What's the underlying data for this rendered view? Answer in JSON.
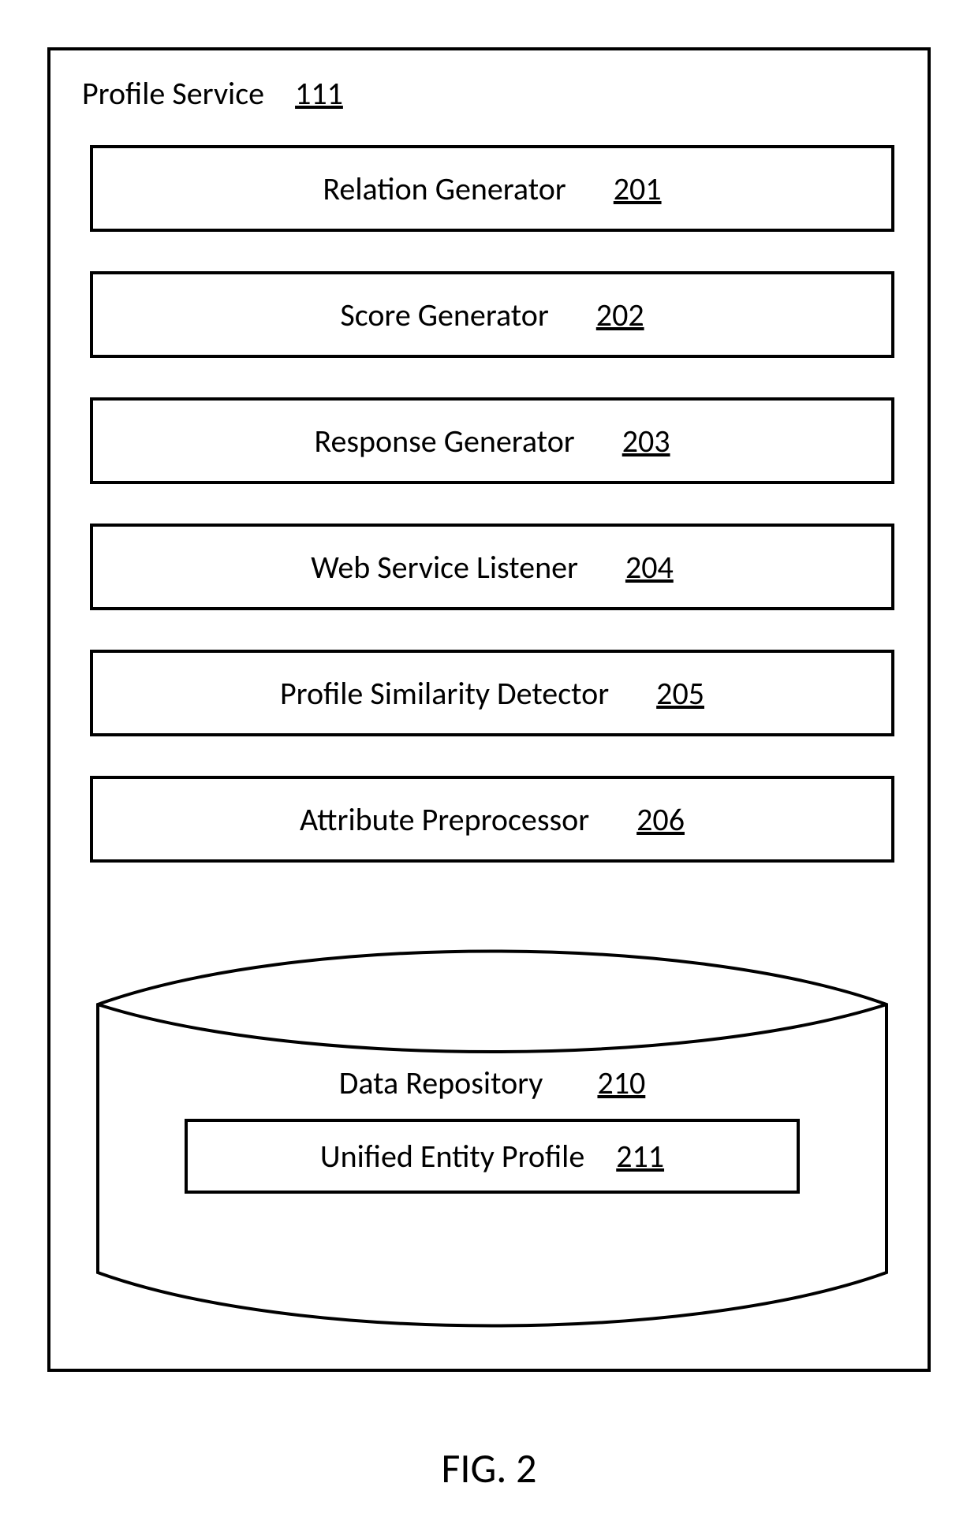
{
  "service": {
    "title": "Profile Service",
    "ref": "111"
  },
  "components": [
    {
      "label": "Relation Generator",
      "ref": "201"
    },
    {
      "label": "Score Generator",
      "ref": "202"
    },
    {
      "label": "Response Generator",
      "ref": "203"
    },
    {
      "label": "Web Service Listener",
      "ref": "204"
    },
    {
      "label": "Profile Similarity Detector",
      "ref": "205"
    },
    {
      "label": "Attribute Preprocessor",
      "ref": "206"
    }
  ],
  "repository": {
    "label": "Data Repository",
    "ref": "210"
  },
  "inner": {
    "label": "Unified Entity Profile",
    "ref": "211"
  },
  "figure": "FIG. 2"
}
